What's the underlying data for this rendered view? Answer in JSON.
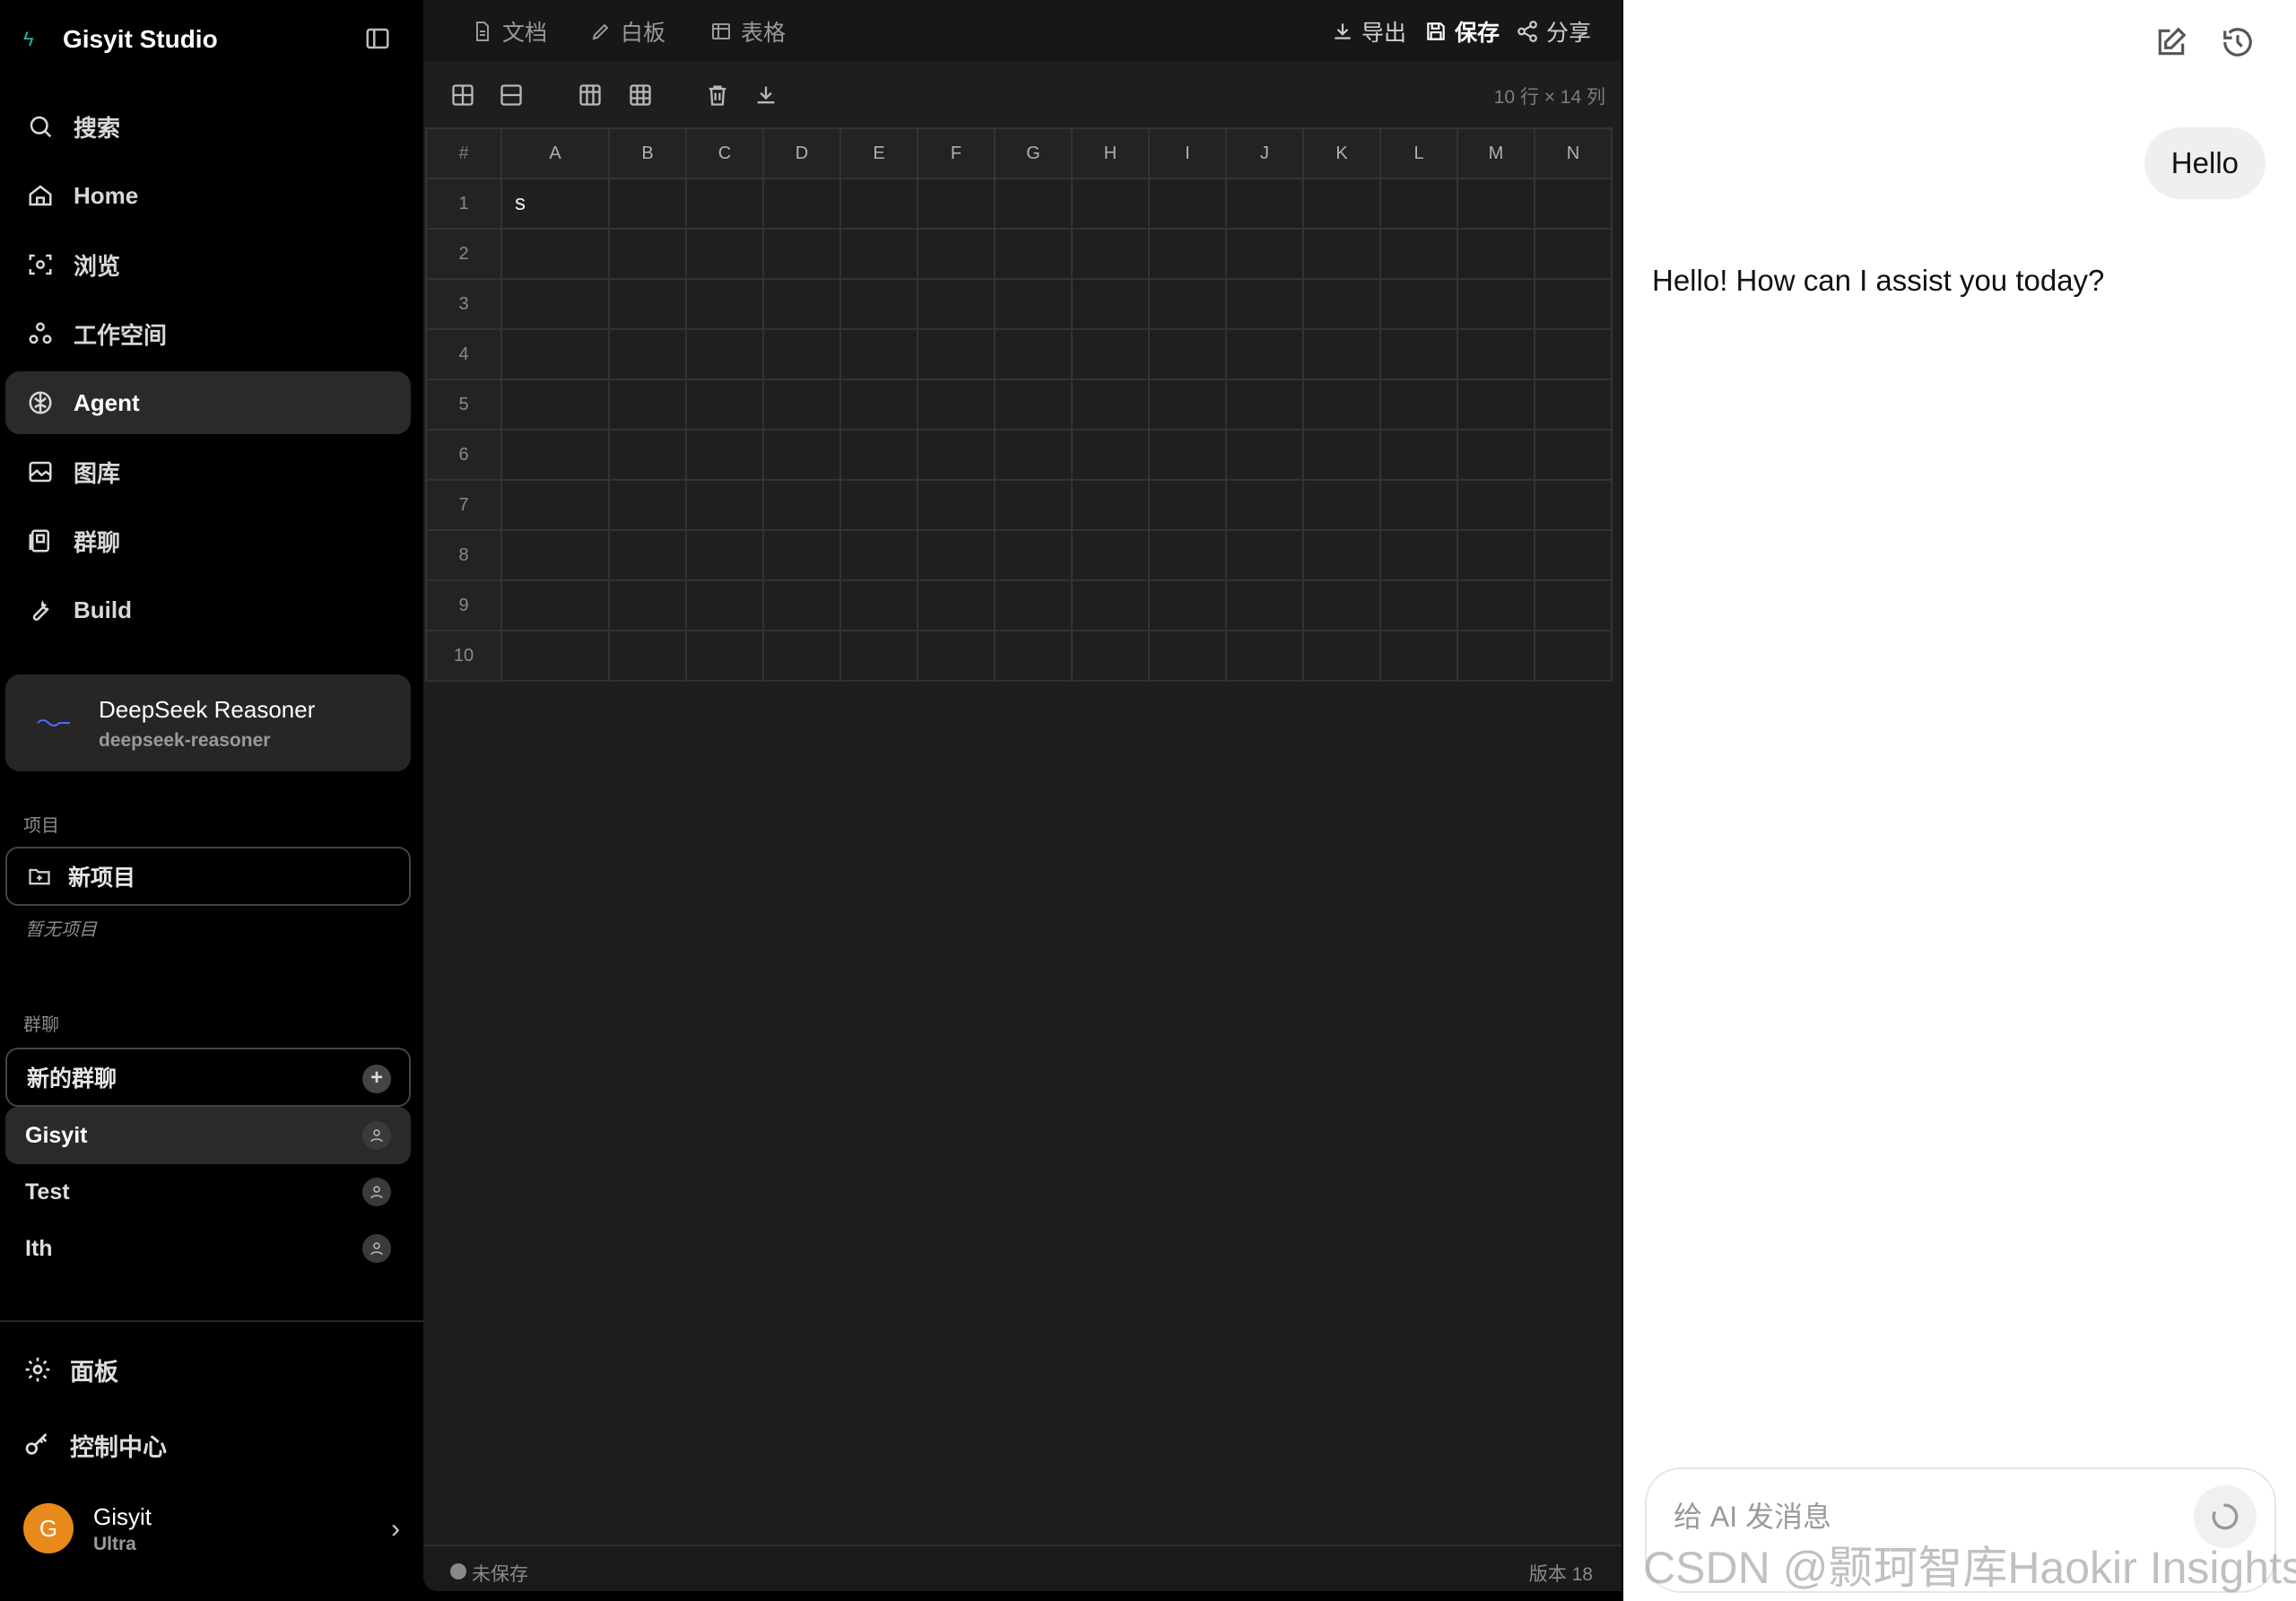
{
  "app": {
    "title": "Gisyit Studio"
  },
  "nav": [
    {
      "label": "搜索",
      "icon": "search-icon"
    },
    {
      "label": "Home",
      "icon": "home-icon"
    },
    {
      "label": "浏览",
      "icon": "scan-icon"
    },
    {
      "label": "工作空间",
      "icon": "workspace-icon"
    },
    {
      "label": "Agent",
      "icon": "brain-icon",
      "active": true
    },
    {
      "label": "图库",
      "icon": "image-icon"
    },
    {
      "label": "群聊",
      "icon": "group-chat-icon"
    },
    {
      "label": "Build",
      "icon": "wrench-icon"
    }
  ],
  "model": {
    "name": "DeepSeek Reasoner",
    "id": "deepseek-reasoner"
  },
  "projects": {
    "label": "项目",
    "new_label": "新项目",
    "empty_text": "暂无项目"
  },
  "group_chats": {
    "label": "群聊",
    "new_label": "新的群聊",
    "items": [
      {
        "name": "Gisyit",
        "active": true
      },
      {
        "name": "Test"
      },
      {
        "name": "Ith"
      }
    ]
  },
  "bottom": {
    "panel_label": "面板",
    "control_label": "控制中心"
  },
  "user": {
    "initial": "G",
    "name": "Gisyit",
    "plan": "Ultra"
  },
  "editor": {
    "tabs": [
      {
        "label": "文档",
        "icon": "document-icon"
      },
      {
        "label": "白板",
        "icon": "pencil-icon"
      },
      {
        "label": "表格",
        "icon": "table-icon"
      }
    ],
    "actions": {
      "export": "导出",
      "save": "保存",
      "share": "分享"
    },
    "dims": "10 行 × 14 列",
    "corner": "#",
    "columns": [
      "A",
      "B",
      "C",
      "D",
      "E",
      "F",
      "G",
      "H",
      "I",
      "J",
      "K",
      "L",
      "M",
      "N"
    ],
    "rows": [
      "1",
      "2",
      "3",
      "4",
      "5",
      "6",
      "7",
      "8",
      "9",
      "10"
    ],
    "cell_A1": "s",
    "status": "未保存",
    "version": "版本 18"
  },
  "chat": {
    "user_message": "Hello",
    "assistant_message": "Hello! How can I assist you today?",
    "input_placeholder": "给 AI 发消息",
    "watermark": "CSDN @颢珂智库Haokir Insights"
  },
  "colors": {
    "accent": "#2bb3a4",
    "avatar": "#e8891c",
    "sidebar_bg": "#000000",
    "editor_bg": "#1e1e1e",
    "chat_bg": "#ffffff"
  }
}
